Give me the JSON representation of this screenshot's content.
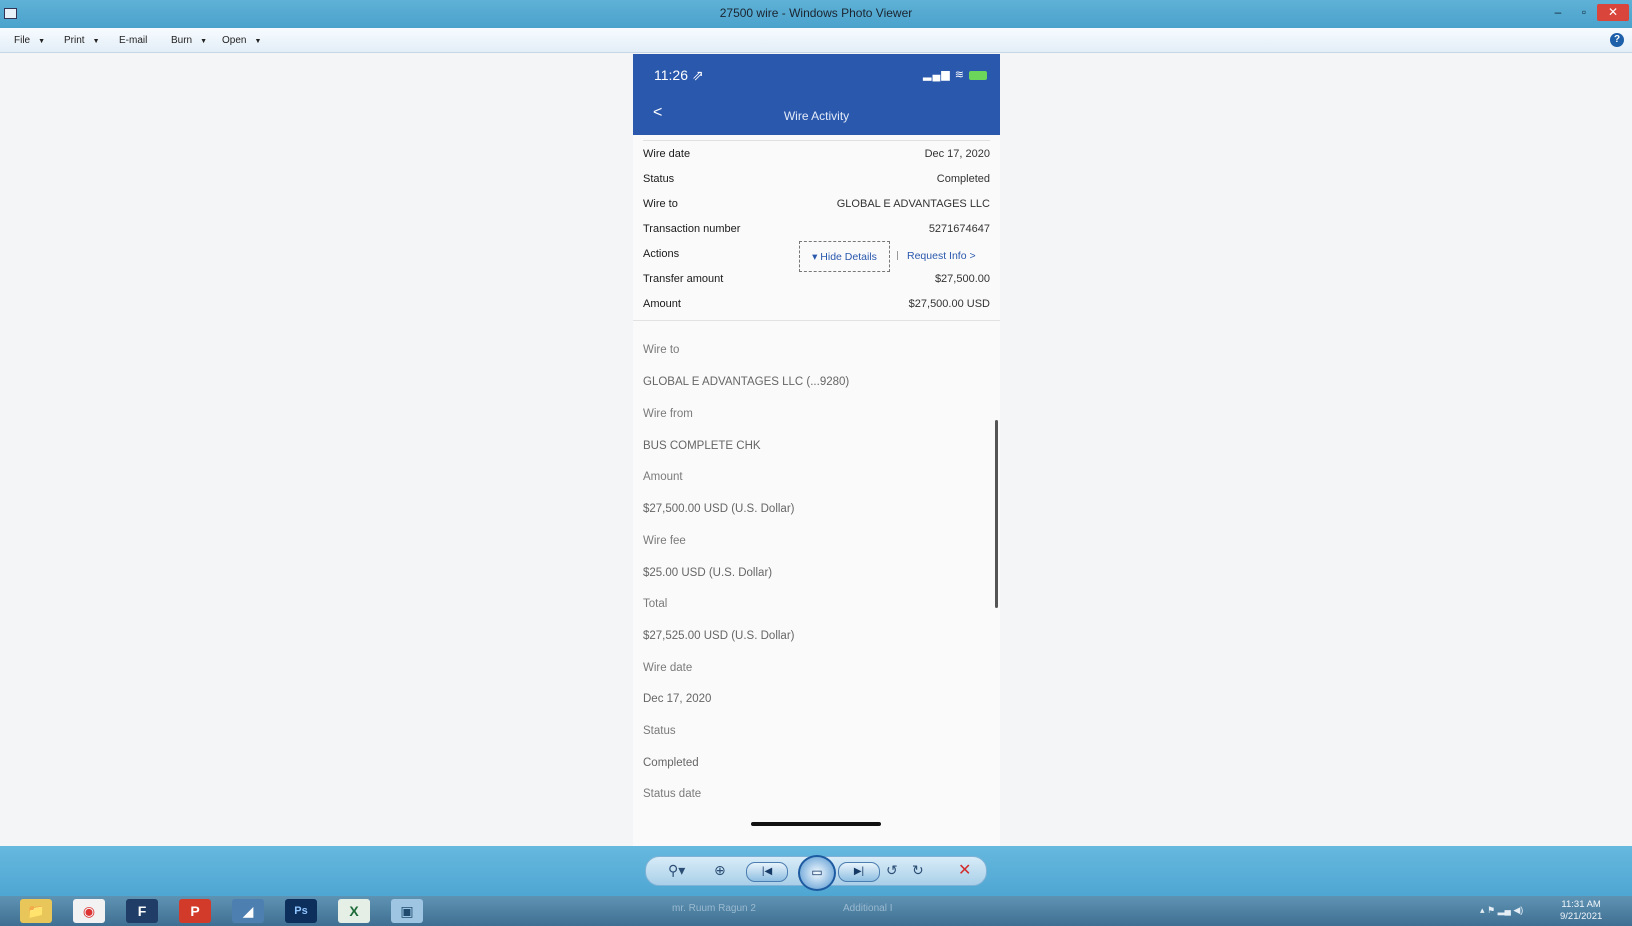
{
  "window": {
    "title": "27500 wire - Windows Photo Viewer",
    "controls": {
      "min": "–",
      "max": "▫",
      "close": "✕"
    }
  },
  "menu": {
    "items": [
      {
        "label": "File",
        "arrow": "▼"
      },
      {
        "label": "Print",
        "arrow": "▼"
      },
      {
        "label": "E-mail",
        "arrow": ""
      },
      {
        "label": "Burn",
        "arrow": "▼"
      },
      {
        "label": "Open",
        "arrow": "▼"
      }
    ],
    "help": "?"
  },
  "phone": {
    "time": "11:26 ⇗",
    "signal": "▂▄▆ ≋",
    "back": "<",
    "title": "Wire Activity",
    "summary": [
      {
        "key": "Wire date",
        "value": "Dec 17, 2020"
      },
      {
        "key": "Status",
        "value": "Completed"
      },
      {
        "key": "Wire to",
        "value": "GLOBAL E ADVANTAGES LLC"
      },
      {
        "key": "Transaction number",
        "value": "5271674647"
      },
      {
        "key": "Actions",
        "value": ""
      },
      {
        "key": "Transfer amount",
        "value": "$27,500.00"
      },
      {
        "key": "Amount",
        "value": "$27,500.00 USD"
      }
    ],
    "actions": {
      "hide_details": "▾ Hide Details",
      "request_info": "Request Info >"
    },
    "details": [
      "Wire to",
      "GLOBAL E ADVANTAGES LLC (...9280)",
      "Wire from",
      "BUS COMPLETE CHK",
      "Amount",
      "$27,500.00 USD (U.S. Dollar)",
      "Wire fee",
      "$25.00 USD (U.S. Dollar)",
      "Total",
      "$27,525.00 USD (U.S. Dollar)",
      "Wire date",
      "Dec 17, 2020",
      "Status",
      "Completed",
      "Status date"
    ]
  },
  "viewer_toolbar": {
    "zoom": "⚲▾",
    "actual_size": "⊕",
    "previous": "|◀",
    "slideshow": "▭",
    "next": "▶|",
    "rotate_ccw": "↺",
    "rotate_cw": "↻",
    "delete": "✕"
  },
  "taskbar": {
    "ghost_text": [
      "mr. Ruum Ragun 2",
      "Additional I"
    ],
    "clock_time": "11:31 AM",
    "clock_date": "9/21/2021",
    "apps": [
      "📁",
      "◉",
      "F",
      "P",
      "◢",
      "Ps",
      "X",
      "▣"
    ]
  }
}
